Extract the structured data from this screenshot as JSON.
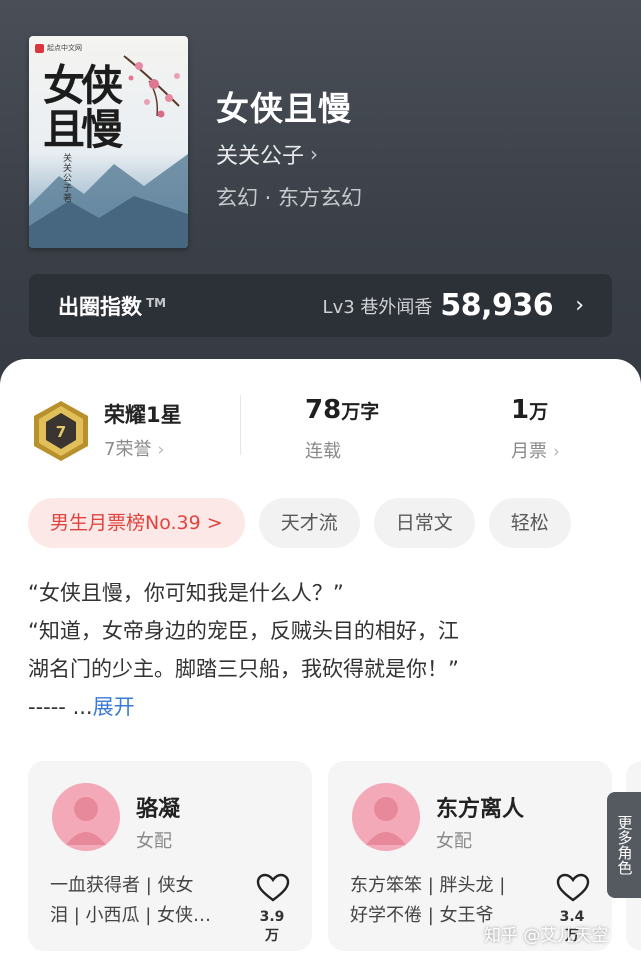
{
  "book": {
    "cover_brand": "起点中文网",
    "cover_title": "女侠且慢",
    "cover_author": "关关公子著",
    "title": "女侠且慢",
    "author": "关关公子",
    "genre": "玄幻 · 东方玄幻"
  },
  "index_bar": {
    "label": "出圈指数",
    "tm": "TM",
    "level": "Lv3 巷外闻香",
    "score": "58,936"
  },
  "stats": {
    "honor_title": "荣耀1星",
    "honor_sub": "7荣誉",
    "badge_number": "7",
    "words_value": "78",
    "words_unit": "万字",
    "words_label": "连载",
    "votes_value": "1",
    "votes_unit": "万",
    "votes_label": "月票"
  },
  "tags": [
    "男生月票榜No.39 >",
    "天才流",
    "日常文",
    "轻松"
  ],
  "synopsis": {
    "line1": "“女侠且慢，你可知我是什么人？”",
    "line2": "“知道，女帝身边的宠臣，反贼头目的相好，江",
    "line3": "湖名门的少主。脚踏三只船，我砍得就是你！”",
    "line4": "----- ...",
    "expand": "展开"
  },
  "roles": [
    {
      "name": "骆凝",
      "type": "女配",
      "desc1": "一血获得者 | 侠女",
      "desc2": "泪 | 小西瓜 | 女侠…",
      "likes": "3.9万"
    },
    {
      "name": "东方离人",
      "type": "女配",
      "desc1": "东方笨笨 | 胖头龙 |",
      "desc2": "好学不倦 | 女王爷",
      "likes": "3.4万"
    }
  ],
  "more_roles": "更多角色",
  "watermark": "知乎 @艾儿天空",
  "colors": {
    "rank_tag_bg": "#fde8e8",
    "rank_tag_text": "#e0443e",
    "expand_link": "#3a7bd5",
    "badge_gold": "#c9a23a"
  }
}
